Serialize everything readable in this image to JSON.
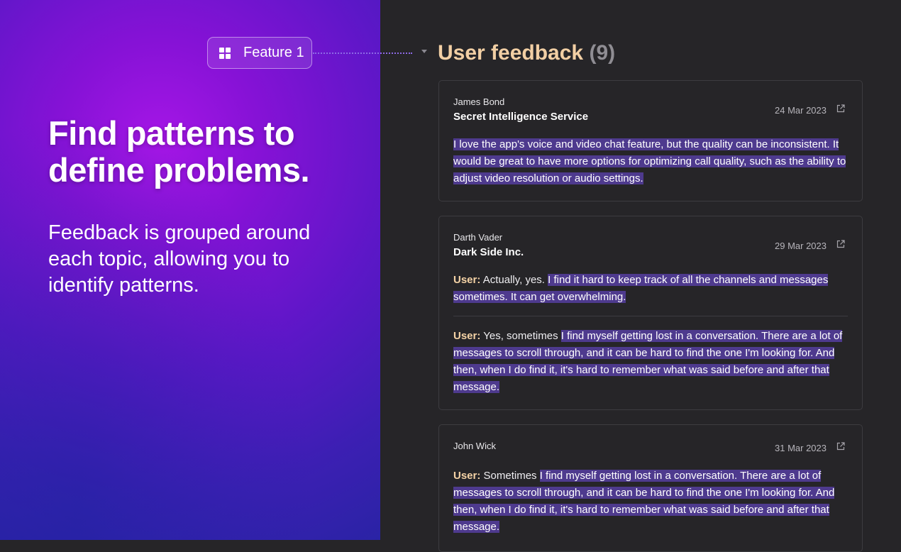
{
  "hero": {
    "feature_chip_label": "Feature 1",
    "headline_line1": "Find patterns to",
    "headline_line2": "define problems.",
    "subtext": "Feedback is grouped around each topic, allowing you to identify patterns."
  },
  "section": {
    "title": "User feedback",
    "count": "(9)"
  },
  "cards": [
    {
      "author": "James Bond",
      "organization": "Secret Intelligence Service",
      "date": "24 Mar 2023",
      "highlight": "I love the app's voice and video chat feature, but the quality can be inconsistent. It would be great to have more options for optimizing call quality, such as the ability to adjust video resolution or audio settings."
    },
    {
      "author": "Darth Vader",
      "organization": "Dark Side Inc.",
      "date": "29 Mar 2023",
      "entries": [
        {
          "label": "User:",
          "prefix": " Actually, yes. ",
          "highlight": "I find it hard to keep track of all the channels and messages sometimes. It can get overwhelming."
        },
        {
          "label": "User:",
          "prefix": " Yes, sometimes ",
          "highlight": "I find myself getting lost in a conversation. There are a lot of messages to scroll through, and it can be hard to find the one I'm looking for. And then, when I do find it, it's hard to remember what was said before and after that message."
        }
      ]
    },
    {
      "author": "John Wick",
      "date": "31 Mar 2023",
      "entries": [
        {
          "label": "User:",
          "prefix": " Sometimes ",
          "highlight": "I find myself getting lost in a conversation. There are a lot of messages to scroll through, and it can be hard to find the one I'm looking for. And then, when I do find it, it's hard to remember what was said before and after that message."
        }
      ]
    }
  ],
  "icons": {
    "feature_chip": "grid-icon",
    "section_toggle": "caret-down-icon",
    "open_card": "external-link-icon"
  },
  "colors": {
    "section_title": "#f2cfa4",
    "highlight": "#4e3a8e",
    "user_label": "#f5d3a6",
    "panel_background": "#262528"
  }
}
